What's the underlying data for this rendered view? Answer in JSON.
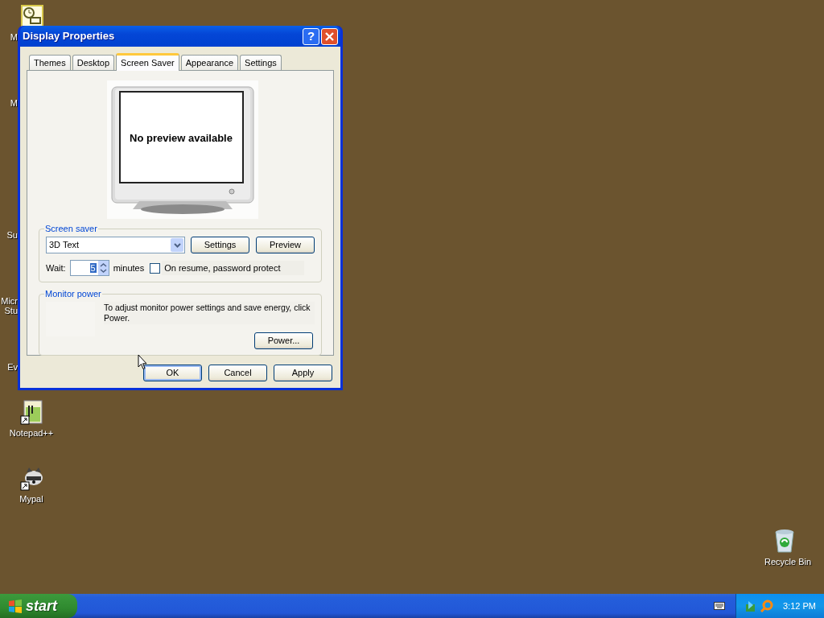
{
  "desktop_icons": [
    {
      "kind": "clock",
      "label": "M",
      "covered": true
    },
    {
      "kind": "none",
      "label": "M",
      "covered": true
    },
    {
      "kind": "empty"
    },
    {
      "kind": "none",
      "label": "Su",
      "covered": true
    },
    {
      "kind": "none",
      "label": "Micr\nStu",
      "covered": true
    },
    {
      "kind": "none",
      "label": "Ev",
      "covered": true
    },
    {
      "kind": "notepad",
      "label": "Notepad++",
      "covered": false
    },
    {
      "kind": "raccoon",
      "label": "Mypal",
      "covered": false
    }
  ],
  "recycle_bin": {
    "label": "Recycle Bin"
  },
  "window": {
    "title": "Display Properties",
    "help": "?",
    "tabs": [
      {
        "label": "Themes",
        "selected": false
      },
      {
        "label": "Desktop",
        "selected": false
      },
      {
        "label": "Screen Saver",
        "selected": true
      },
      {
        "label": "Appearance",
        "selected": false
      },
      {
        "label": "Settings",
        "selected": false
      }
    ],
    "preview": {
      "text": "No preview available"
    },
    "screen_saver": {
      "legend": "Screen saver",
      "selection": "3D Text",
      "buttons": [
        "Settings",
        "Preview"
      ],
      "wait_label": "Wait:",
      "wait_value": "5",
      "minutes_label": "minutes",
      "password": {
        "label": "On resume, password protect",
        "checked": false
      }
    },
    "monitor_power": {
      "legend": "Monitor power",
      "text": "To adjust monitor power settings and save energy, click Power.",
      "button": "Power..."
    },
    "buttons": [
      {
        "label": "OK",
        "default": true
      },
      {
        "label": "Cancel",
        "default": false
      },
      {
        "label": "Apply",
        "default": false
      }
    ]
  },
  "taskbar": {
    "start": "start",
    "clock": "3:12 PM"
  }
}
